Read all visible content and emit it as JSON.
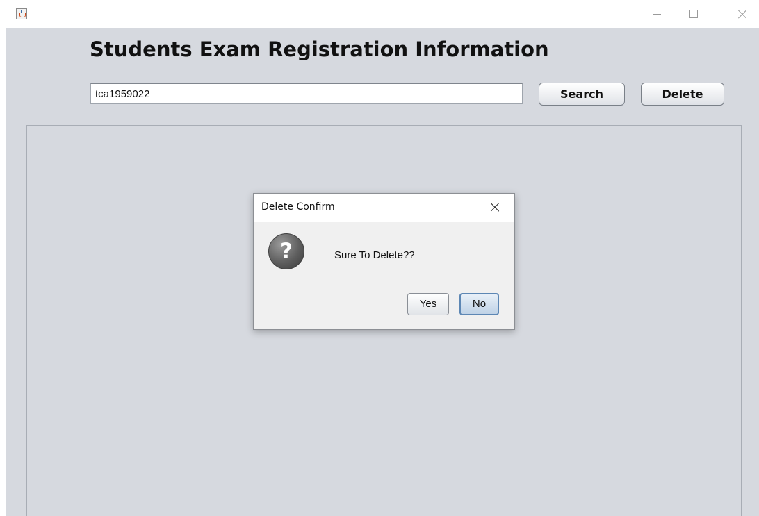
{
  "window": {
    "icon": "java-coffee-cup-icon",
    "controls": {
      "minimize_icon": "minimize-icon",
      "maximize_icon": "maximize-icon",
      "close_icon": "close-icon"
    }
  },
  "main": {
    "title": "Students Exam Registration Information",
    "search": {
      "value": "tca1959022",
      "placeholder": ""
    },
    "search_button": "Search",
    "delete_button": "Delete",
    "background_color": "#d6d9df"
  },
  "dialog": {
    "title": "Delete Confirm",
    "icon": "question-icon",
    "icon_glyph": "?",
    "message": "Sure To Delete??",
    "yes_button": "Yes",
    "no_button": "No",
    "focused_button_color": "#5d87b4"
  }
}
